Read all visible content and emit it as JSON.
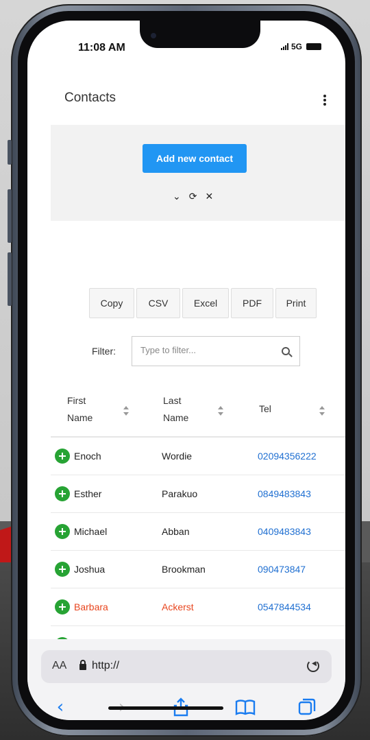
{
  "status": {
    "time": "11:08 AM",
    "network": "5G"
  },
  "header": {
    "title": "Contacts"
  },
  "actions": {
    "add_label": "Add new contact"
  },
  "export_buttons": [
    "Copy",
    "CSV",
    "Excel",
    "PDF",
    "Print"
  ],
  "filter": {
    "label": "Filter:",
    "placeholder": "Type to filter..."
  },
  "table": {
    "headers": [
      "First Name",
      "Last Name",
      "Tel"
    ],
    "rows": [
      {
        "first": "Enoch",
        "last": "Wordie",
        "tel": "02094356222"
      },
      {
        "first": "Esther",
        "last": "Parakuo",
        "tel": "0849483843"
      },
      {
        "first": "Michael",
        "last": "Abban",
        "tel": "0409483843"
      },
      {
        "first": "Joshua",
        "last": "Brookman",
        "tel": "090473847"
      },
      {
        "first": "Barbara",
        "last": "Ackerst",
        "tel": "0547844534"
      }
    ]
  },
  "browser": {
    "text_size": "AA",
    "url": "http://"
  },
  "colors": {
    "accent": "#2196f3",
    "add_row": "#27a334",
    "link": "#1f6fd1",
    "highlight": "#e8451e"
  }
}
